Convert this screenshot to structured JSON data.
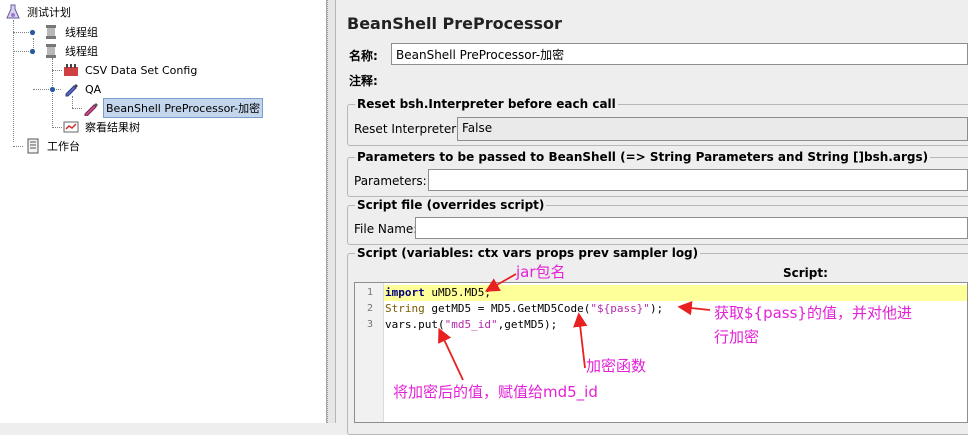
{
  "tree": {
    "nodes": [
      {
        "label": "测试计划",
        "icon": "flask-icon"
      },
      {
        "label": "线程组",
        "icon": "spool-icon"
      },
      {
        "label": "线程组",
        "icon": "spool-icon"
      },
      {
        "label": "CSV Data Set Config",
        "icon": "csv-config-icon"
      },
      {
        "label": "QA",
        "icon": "sampler-pen-icon"
      },
      {
        "label": "BeanShell PreProcessor-加密",
        "icon": "preprocessor-pen-icon"
      },
      {
        "label": "察看结果树",
        "icon": "results-tree-icon"
      },
      {
        "label": "工作台",
        "icon": "workbench-icon"
      }
    ]
  },
  "panel": {
    "title": "BeanShell PreProcessor",
    "name_label": "名称:",
    "name_value": "BeanShell PreProcessor-加密",
    "comment_label": "注释:",
    "reset_group": {
      "title": "Reset bsh.Interpreter before each call",
      "label": "Reset Interpreter:",
      "value": "False"
    },
    "params_group": {
      "title": "Parameters to be passed to BeanShell (=> String Parameters and String []bsh.args)",
      "label": "Parameters:",
      "value": ""
    },
    "file_group": {
      "title": "Script file (overrides script)",
      "label": "File Name:",
      "value": ""
    },
    "script_group": {
      "title": "Script (variables: ctx vars props prev sampler log)",
      "script_label": "Script:"
    }
  },
  "script": {
    "line_numbers": [
      "1",
      "2",
      "3"
    ],
    "line1": {
      "kw": "import",
      "rest": " uMD5.MD5;"
    },
    "line2": {
      "type": "String",
      "mid": " getMD5 = MD5.GetMD5Code(",
      "str": "\"${pass}\"",
      "end": ");"
    },
    "line3": {
      "start": "vars.put(",
      "str": "\"md5_id\"",
      "end": ",getMD5);"
    }
  },
  "annotations": {
    "jar": "jar包名",
    "get": "获取${pass}的值，并对他进",
    "get2": "行加密",
    "func": "加密函数",
    "assign": "将加密后的值，赋值给md5_id"
  },
  "colors": {
    "annotation": "#e321d6",
    "selection": "#c4d6ec",
    "highlight": "#ffff99"
  }
}
